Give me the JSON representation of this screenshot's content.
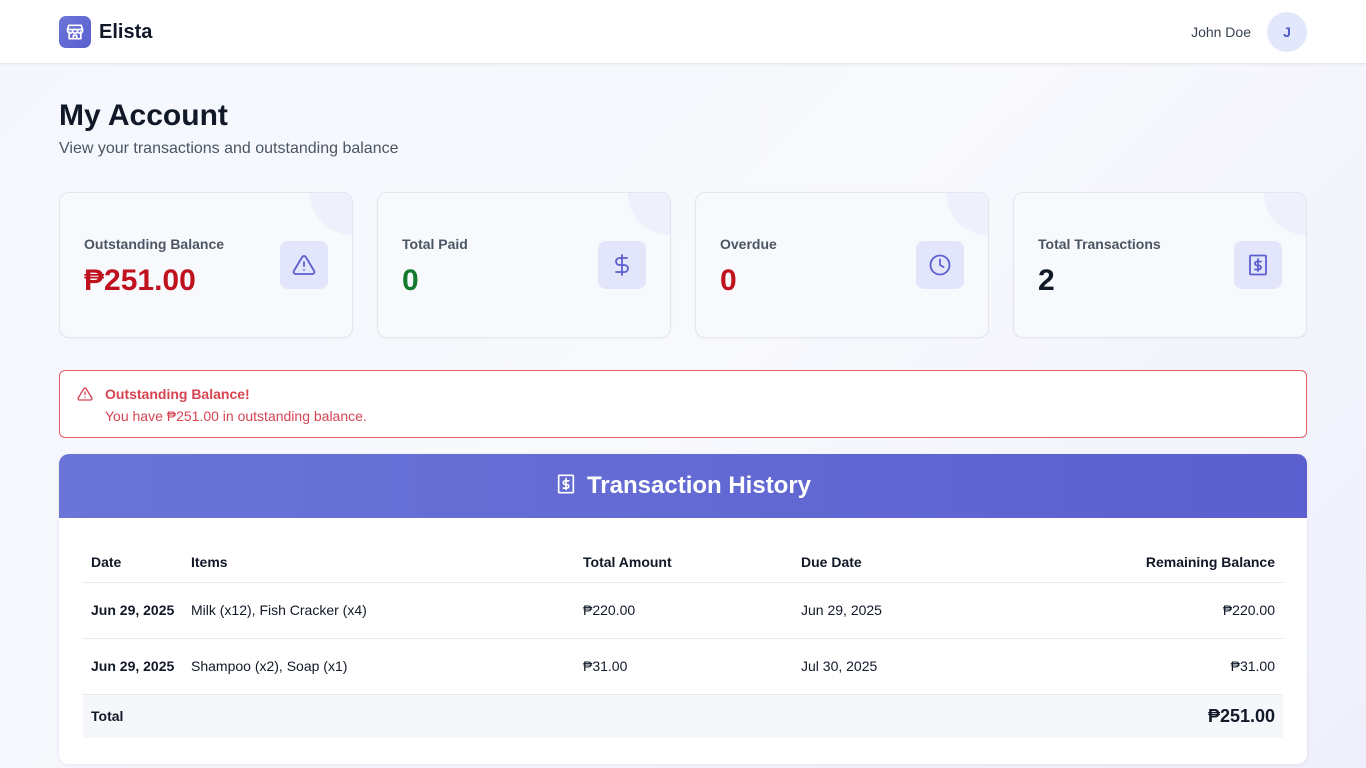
{
  "nav": {
    "brand": "Elista",
    "brand_icon": "store-icon",
    "user_name": "John Doe",
    "avatar_initial": "J"
  },
  "page": {
    "title": "My Account",
    "subtitle": "View your transactions and outstanding balance"
  },
  "stats": [
    {
      "label": "Outstanding Balance",
      "value": "₱251.00",
      "color": "#c0111f",
      "icon": "warning-triangle-icon"
    },
    {
      "label": "Total Paid",
      "value": "0",
      "color": "#137a2e",
      "icon": "dollar-icon"
    },
    {
      "label": "Overdue",
      "value": "0",
      "color": "#c0111f",
      "icon": "clock-icon"
    },
    {
      "label": "Total Transactions",
      "value": "2",
      "color": "#111827",
      "icon": "receipt-icon"
    }
  ],
  "alert": {
    "title": "Outstanding Balance!",
    "message": "You have ₱251.00 in outstanding balance.",
    "color": "#d64452"
  },
  "transactions": {
    "title": "Transaction History",
    "columns": [
      "Date",
      "Items",
      "Total Amount",
      "Due Date",
      "Remaining Balance"
    ],
    "rows": [
      {
        "date": "Jun 29, 2025",
        "items": "Milk (x12), Fish Cracker (x4)",
        "total": "₱220.00",
        "due": "Jun 29, 2025",
        "remaining": "₱220.00"
      },
      {
        "date": "Jun 29, 2025",
        "items": "Shampoo (x2), Soap (x1)",
        "total": "₱31.00",
        "due": "Jul 30, 2025",
        "remaining": "₱31.00"
      }
    ],
    "total_label": "Total",
    "total_value": "₱251.00"
  },
  "colors": {
    "accent": "#5c5fcf",
    "accent_light": "#e3e6fb",
    "danger": "#c0111f",
    "success": "#137a2e"
  }
}
